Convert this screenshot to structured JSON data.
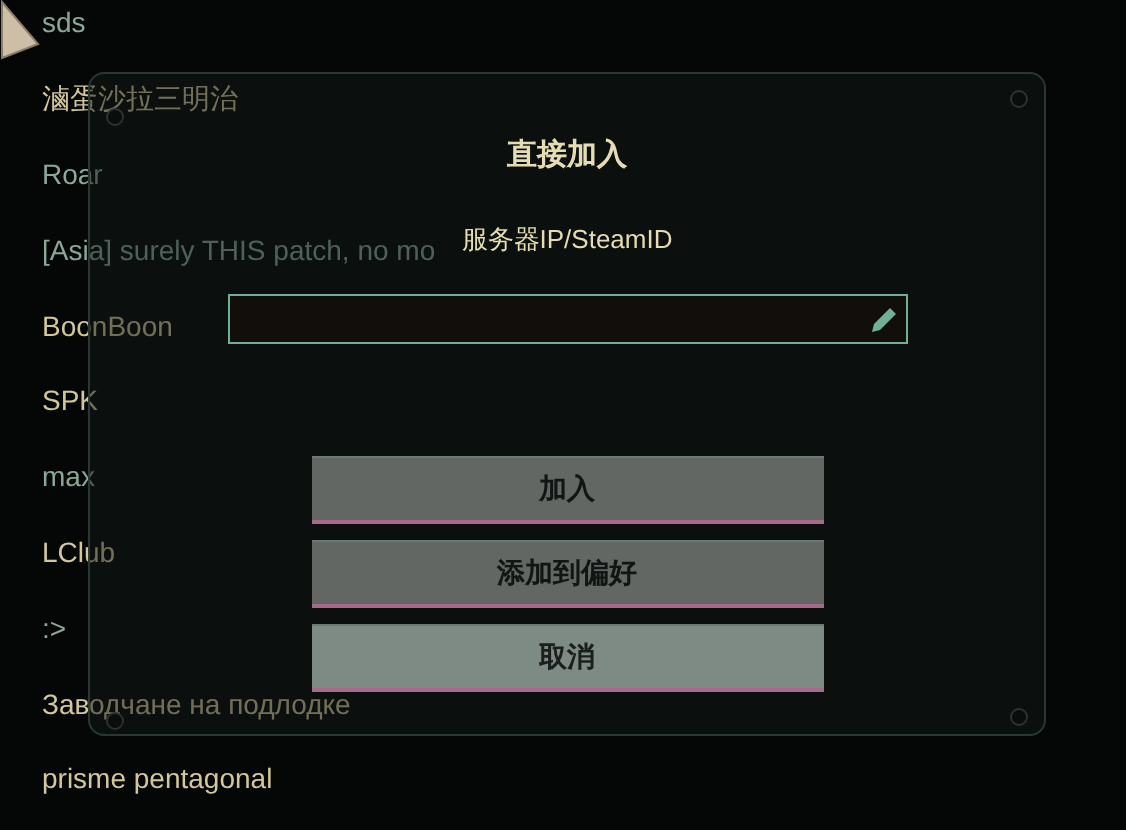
{
  "servers": [
    {
      "name": "sds",
      "color": "#8aa898"
    },
    {
      "name": "滷蛋沙拉三明治",
      "color": "#d3c79a"
    },
    {
      "name": "Roar",
      "color": "#8aa898"
    },
    {
      "name": "[Asia] surely THIS patch, no mo",
      "color": "#8aa898"
    },
    {
      "name": "BoonBoon",
      "color": "#d3c79a"
    },
    {
      "name": "SPK",
      "color": "#d3c79a"
    },
    {
      "name": "max",
      "color": "#8aa898"
    },
    {
      "name": "LClub",
      "color": "#d3c79a"
    },
    {
      "name": ":>",
      "color": "#8aa898"
    },
    {
      "name": "Заводчане на подлодке",
      "color": "#d3c79a"
    },
    {
      "name": "prisme pentagonal",
      "color": "#d3c79a"
    }
  ],
  "dialog": {
    "title": "直接加入",
    "field_label": "服务器IP/SteamID",
    "buttons": [
      {
        "label": "加入",
        "disabled": true
      },
      {
        "label": "添加到偏好",
        "disabled": true
      },
      {
        "label": "取消",
        "disabled": false
      }
    ]
  }
}
